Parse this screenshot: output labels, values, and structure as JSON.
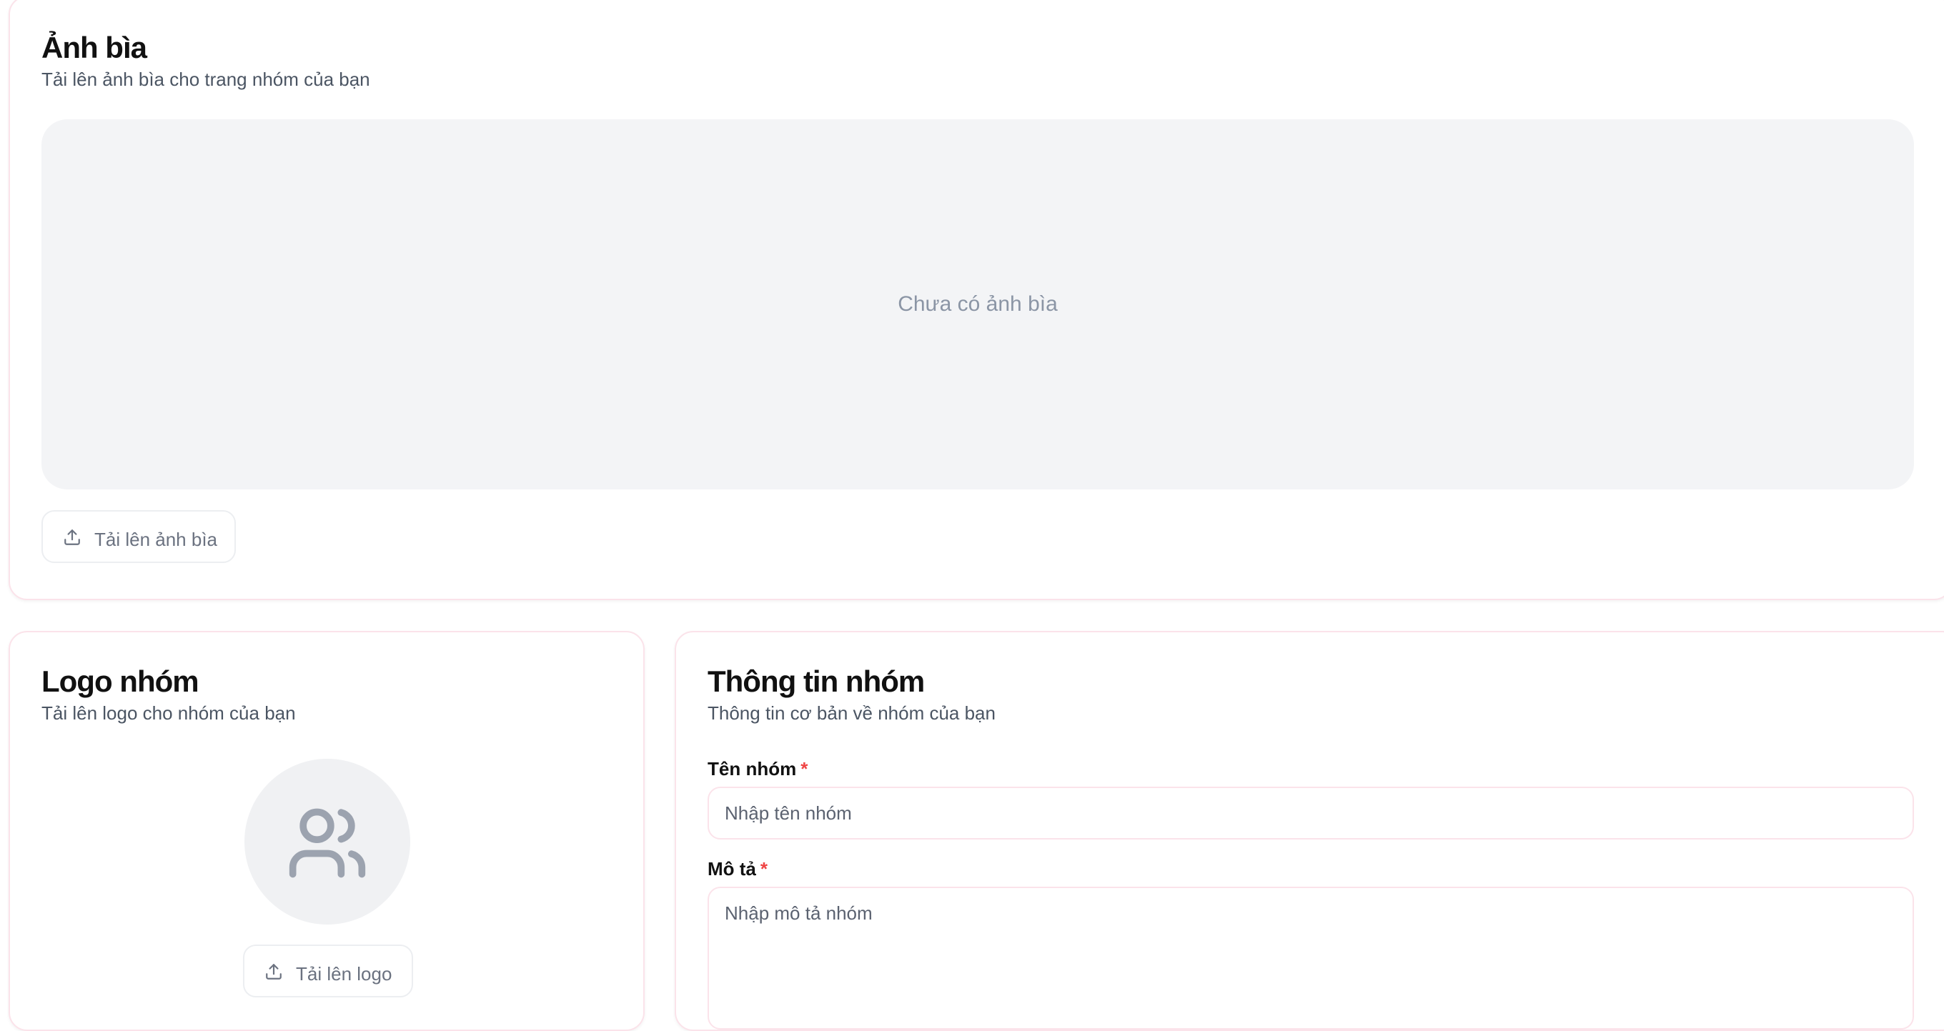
{
  "cover": {
    "title": "Ảnh bìa",
    "subtitle": "Tải lên ảnh bìa cho trang nhóm của bạn",
    "placeholder": "Chưa có ảnh bìa",
    "upload_label": "Tải lên ảnh bìa",
    "upload_icon": "upload-icon"
  },
  "logo": {
    "title": "Logo nhóm",
    "subtitle": "Tải lên logo cho nhóm của bạn",
    "avatar_icon": "users-icon",
    "upload_label": "Tải lên logo",
    "upload_icon": "upload-icon"
  },
  "info": {
    "title": "Thông tin nhóm",
    "subtitle": "Thông tin cơ bản về nhóm của bạn",
    "name_label": "Tên nhóm",
    "name_placeholder": "Nhập tên nhóm",
    "name_value": "",
    "description_label": "Mô tả",
    "description_placeholder": "Nhập mô tả nhóm",
    "description_value": "",
    "required_marker": "*"
  },
  "colors": {
    "required": "#ef4444",
    "card_border": "#fbe3ea",
    "placeholder_bg": "#f3f4f6",
    "muted_text": "#6b7280"
  }
}
